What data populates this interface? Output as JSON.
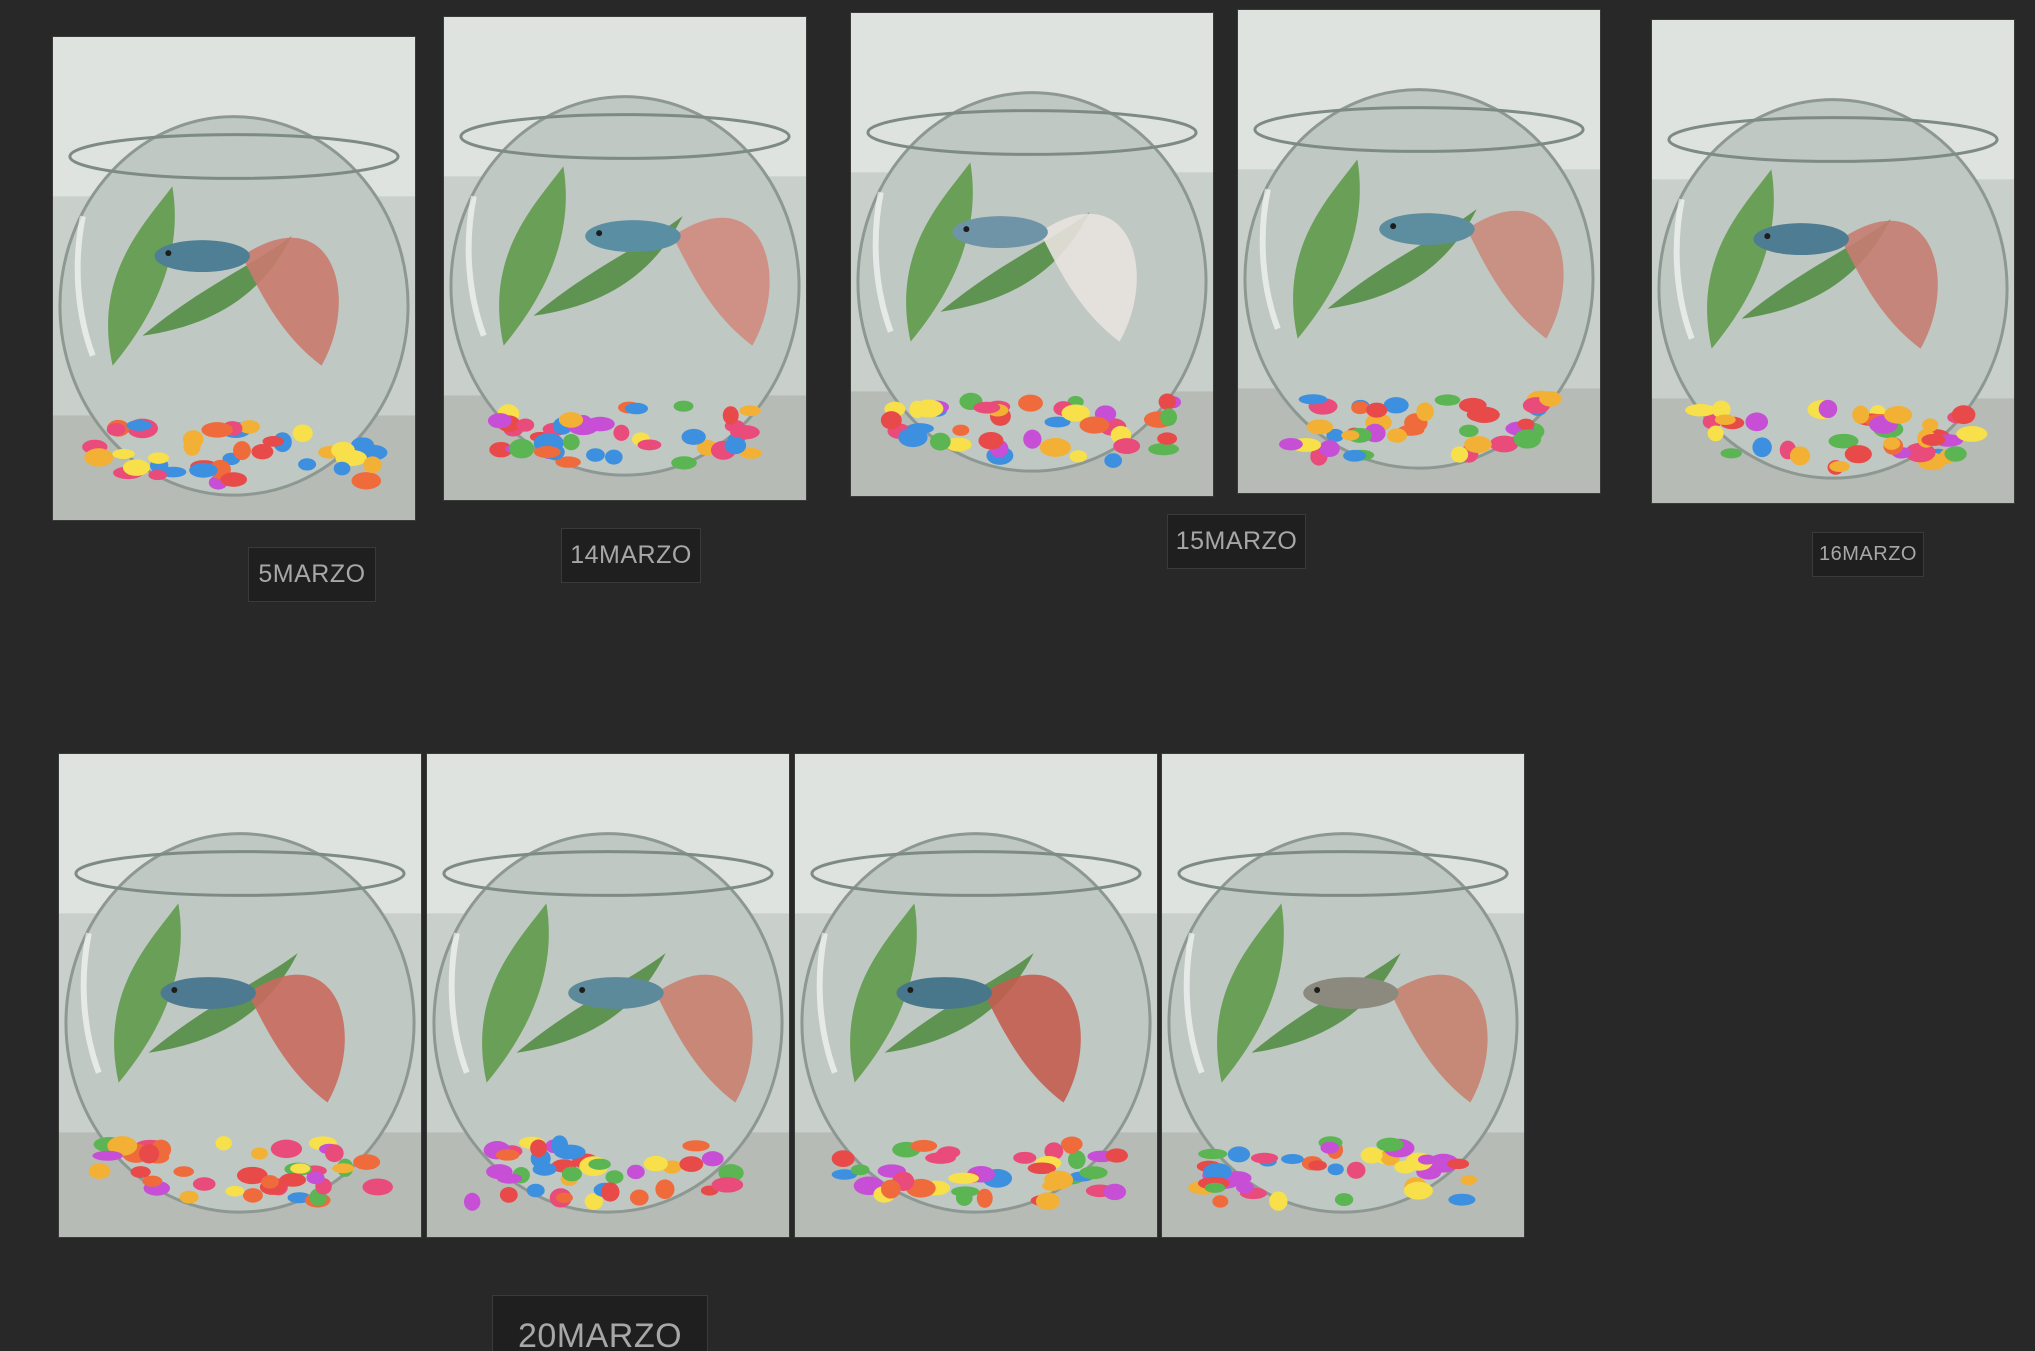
{
  "gallery": {
    "rows": [
      {
        "photos": [
          {
            "subject": "betta fish in glass bowl with plant",
            "fin_color": "#c97a6e",
            "body_color": "#4f7f95"
          },
          {
            "subject": "betta fish in glass bowl with plant",
            "fin_color": "#d08a80",
            "body_color": "#5a8ea3"
          },
          {
            "subject": "betta fish in glass bowl with plant",
            "fin_color": "#e8e2de",
            "body_color": "#6f94a8"
          },
          {
            "subject": "betta fish in glass bowl with plant",
            "fin_color": "#c98b7c",
            "body_color": "#5d8ea0"
          },
          {
            "subject": "betta fish in glass bowl with plant",
            "fin_color": "#c77d72",
            "body_color": "#4e7c92"
          }
        ],
        "labels": [
          "5MARZO",
          "14MARZO",
          "15MARZO",
          "16MARZO"
        ]
      },
      {
        "photos": [
          {
            "subject": "betta fish in glass bowl with plant",
            "fin_color": "#c96a5e",
            "body_color": "#4d7a90"
          },
          {
            "subject": "betta fish in glass bowl near window",
            "fin_color": "#c9806f",
            "body_color": "#5c8a9a"
          },
          {
            "subject": "betta fish in glass bowl with plant",
            "fin_color": "#c35d4f",
            "body_color": "#48778c"
          },
          {
            "subject": "betta fish in glass bowl with plant",
            "fin_color": "#c7826f",
            "body_color": "#8c8a7e"
          }
        ],
        "labels": [
          "20MARZO"
        ]
      }
    ]
  }
}
